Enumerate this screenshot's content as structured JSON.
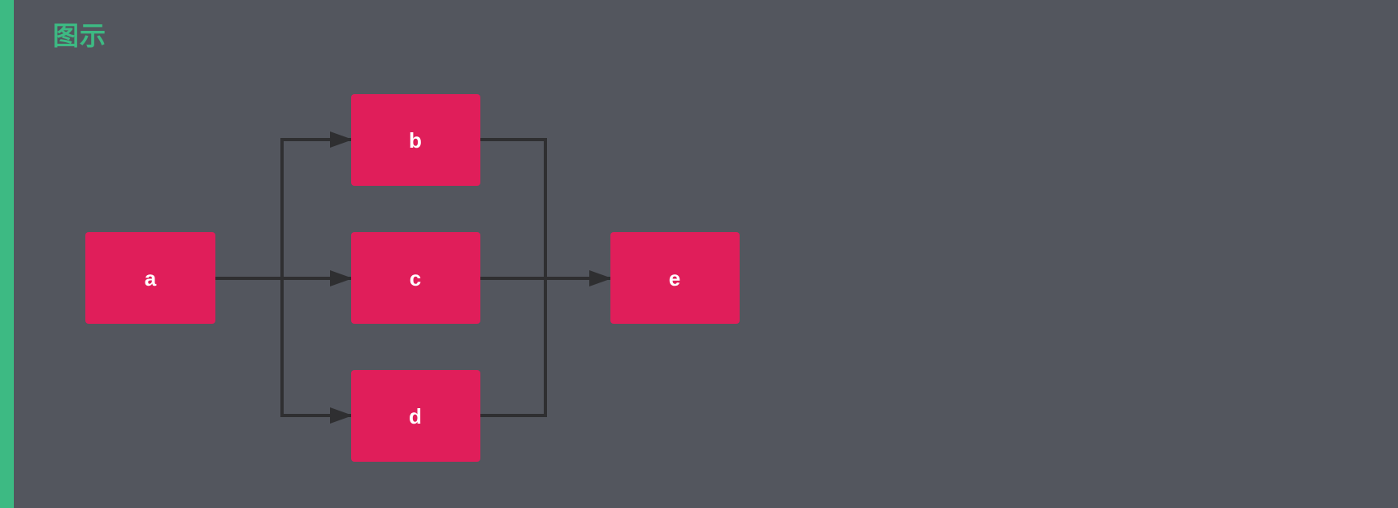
{
  "colors": {
    "background": "#53565e",
    "accent": "#3dba83",
    "node_fill": "#e01e5a",
    "node_text": "#ffffff",
    "edge": "#2f2f31"
  },
  "title": "图示",
  "nodes": [
    {
      "id": "a",
      "label": "a"
    },
    {
      "id": "b",
      "label": "b"
    },
    {
      "id": "c",
      "label": "c"
    },
    {
      "id": "d",
      "label": "d"
    },
    {
      "id": "e",
      "label": "e"
    }
  ],
  "edges": [
    {
      "from": "a",
      "to": "b"
    },
    {
      "from": "a",
      "to": "c"
    },
    {
      "from": "a",
      "to": "d"
    },
    {
      "from": "b",
      "to": "e"
    },
    {
      "from": "c",
      "to": "e"
    },
    {
      "from": "d",
      "to": "e"
    }
  ]
}
